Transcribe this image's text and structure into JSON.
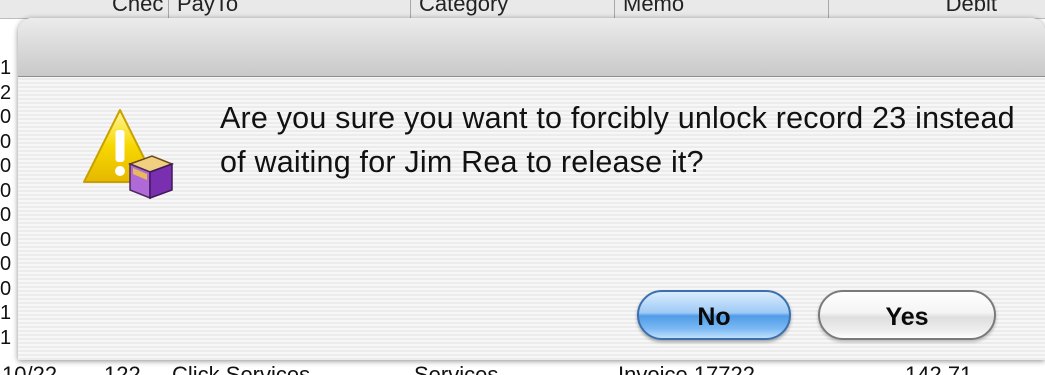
{
  "background_table": {
    "headers": [
      "Chec",
      "PayTo",
      "Category",
      "Memo",
      "Debit"
    ],
    "left_column_digits": [
      "1",
      "2",
      "0",
      "0",
      "0",
      "0",
      "0",
      "0",
      "0",
      "0",
      "1",
      "1"
    ],
    "bottom_row_fragments": [
      "10/22",
      "122",
      "Click Services",
      "Services",
      "Invoice 17722",
      "142.71"
    ]
  },
  "dialog": {
    "message": "Are you sure you want to forcibly unlock record 23 instead of waiting for Jim Rea to release it?",
    "icon": "warning-icon",
    "buttons": {
      "no_label": "No",
      "yes_label": "Yes"
    },
    "default_button": "No",
    "colors": {
      "default_button_blue": "#6fb0f0",
      "warning_yellow": "#f5d400",
      "cube_purple": "#8a3fbf"
    }
  }
}
